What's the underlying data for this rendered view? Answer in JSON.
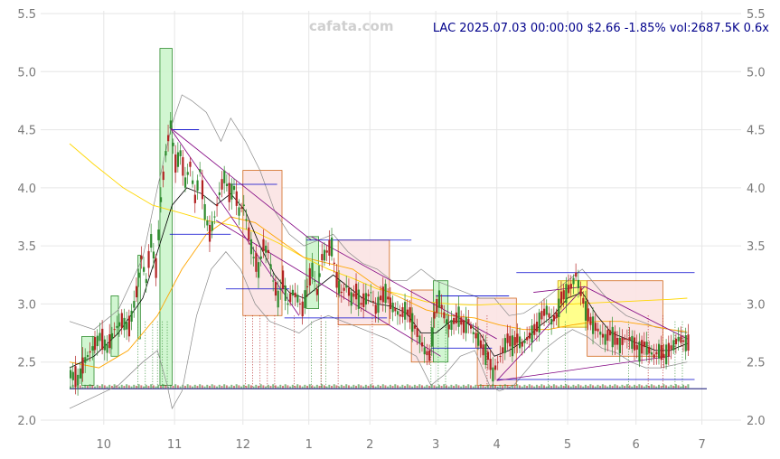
{
  "watermark": "cafata.com",
  "header": "LAC 2025.07.03 00:00:00 $2.66 -1.85% vol:2687.5K 0.6x",
  "colors": {
    "up": "#2e8b2e",
    "down": "#b22222",
    "box_green_fill": "#ccf5cc",
    "box_red_fill": "#fbe3e3",
    "box_red_edge": "#d2691e",
    "box_yellow_fill": "#ffff66",
    "ma_short": "#000000",
    "ma_mid": "#ffa500",
    "ma_long": "#ffd700",
    "bollinger": "#888888",
    "trend": "#800080",
    "level": "#0000cd",
    "grid": "#e6e6e6",
    "tick": "#7a7a7a"
  },
  "chart_data": {
    "type": "candlestick",
    "ylim": [
      2.0,
      5.5
    ],
    "yticks": [
      "2.0",
      "2.5",
      "3.0",
      "3.5",
      "4.0",
      "4.5",
      "5.0",
      "5.5"
    ],
    "ytick_values": [
      2.0,
      2.5,
      3.0,
      3.5,
      4.0,
      4.5,
      5.0,
      5.5
    ],
    "xlim": [
      0,
      261
    ],
    "xtick_labels": [
      "10",
      "11",
      "12",
      "1",
      "2",
      "3",
      "4",
      "5",
      "6",
      "7"
    ],
    "xtick_positions": [
      14,
      43,
      71,
      98,
      123,
      150,
      175,
      204,
      232,
      259
    ],
    "price_series": [
      [
        0,
        2.4
      ],
      [
        3,
        2.35
      ],
      [
        6,
        2.52
      ],
      [
        9,
        2.62
      ],
      [
        12,
        2.72
      ],
      [
        15,
        2.62
      ],
      [
        18,
        2.78
      ],
      [
        21,
        2.85
      ],
      [
        24,
        2.8
      ],
      [
        27,
        3.1
      ],
      [
        29,
        3.4
      ],
      [
        31,
        3.2
      ],
      [
        33,
        3.55
      ],
      [
        35,
        3.3
      ],
      [
        37,
        3.9
      ],
      [
        39,
        4.3
      ],
      [
        41,
        4.55
      ],
      [
        43,
        4.2
      ],
      [
        45,
        4.3
      ],
      [
        47,
        4.05
      ],
      [
        49,
        4.2
      ],
      [
        51,
        3.9
      ],
      [
        53,
        4.15
      ],
      [
        55,
        3.8
      ],
      [
        57,
        3.6
      ],
      [
        59,
        3.75
      ],
      [
        61,
        3.95
      ],
      [
        63,
        4.1
      ],
      [
        65,
        3.95
      ],
      [
        67,
        4.0
      ],
      [
        69,
        3.8
      ],
      [
        71,
        3.85
      ],
      [
        73,
        3.6
      ],
      [
        75,
        3.4
      ],
      [
        77,
        3.3
      ],
      [
        79,
        3.5
      ],
      [
        81,
        3.45
      ],
      [
        83,
        3.2
      ],
      [
        85,
        3.05
      ],
      [
        87,
        3.2
      ],
      [
        89,
        3.0
      ],
      [
        91,
        3.1
      ],
      [
        93,
        3.05
      ],
      [
        95,
        2.95
      ],
      [
        97,
        3.15
      ],
      [
        99,
        3.3
      ],
      [
        101,
        3.1
      ],
      [
        103,
        3.4
      ],
      [
        105,
        3.45
      ],
      [
        107,
        3.5
      ],
      [
        109,
        3.2
      ],
      [
        111,
        3.1
      ],
      [
        113,
        3.15
      ],
      [
        115,
        3.05
      ],
      [
        117,
        3.1
      ],
      [
        119,
        3.0
      ],
      [
        121,
        3.05
      ],
      [
        123,
        3.1
      ],
      [
        125,
        2.95
      ],
      [
        127,
        3.05
      ],
      [
        129,
        3.1
      ],
      [
        131,
        3.0
      ],
      [
        133,
        2.95
      ],
      [
        135,
        2.9
      ],
      [
        137,
        2.95
      ],
      [
        139,
        2.9
      ],
      [
        141,
        2.8
      ],
      [
        143,
        2.7
      ],
      [
        145,
        2.6
      ],
      [
        147,
        2.55
      ],
      [
        149,
        2.9
      ],
      [
        151,
        3.05
      ],
      [
        153,
        2.9
      ],
      [
        155,
        2.8
      ],
      [
        157,
        2.85
      ],
      [
        159,
        2.9
      ],
      [
        161,
        2.8
      ],
      [
        163,
        2.85
      ],
      [
        165,
        2.75
      ],
      [
        167,
        2.7
      ],
      [
        169,
        2.6
      ],
      [
        171,
        2.55
      ],
      [
        173,
        2.4
      ],
      [
        175,
        2.5
      ],
      [
        177,
        2.6
      ],
      [
        179,
        2.7
      ],
      [
        181,
        2.65
      ],
      [
        183,
        2.7
      ],
      [
        185,
        2.65
      ],
      [
        187,
        2.7
      ],
      [
        189,
        2.75
      ],
      [
        191,
        2.8
      ],
      [
        193,
        2.9
      ],
      [
        195,
        2.95
      ],
      [
        197,
        2.85
      ],
      [
        199,
        2.9
      ],
      [
        201,
        3.05
      ],
      [
        203,
        3.1
      ],
      [
        205,
        3.15
      ],
      [
        207,
        3.25
      ],
      [
        209,
        3.1
      ],
      [
        211,
        2.95
      ],
      [
        213,
        2.85
      ],
      [
        215,
        2.8
      ],
      [
        217,
        2.75
      ],
      [
        219,
        2.7
      ],
      [
        221,
        2.75
      ],
      [
        223,
        2.7
      ],
      [
        225,
        2.65
      ],
      [
        227,
        2.7
      ],
      [
        229,
        2.7
      ],
      [
        231,
        2.65
      ],
      [
        233,
        2.6
      ],
      [
        235,
        2.65
      ],
      [
        237,
        2.6
      ],
      [
        239,
        2.55
      ],
      [
        241,
        2.6
      ],
      [
        243,
        2.55
      ],
      [
        245,
        2.6
      ],
      [
        247,
        2.65
      ],
      [
        249,
        2.7
      ],
      [
        251,
        2.68
      ],
      [
        253,
        2.66
      ]
    ],
    "ma_short": [
      [
        0,
        2.45
      ],
      [
        10,
        2.55
      ],
      [
        20,
        2.75
      ],
      [
        30,
        3.05
      ],
      [
        36,
        3.45
      ],
      [
        42,
        3.85
      ],
      [
        48,
        4.0
      ],
      [
        54,
        3.95
      ],
      [
        60,
        3.85
      ],
      [
        66,
        3.95
      ],
      [
        72,
        3.8
      ],
      [
        78,
        3.5
      ],
      [
        84,
        3.25
      ],
      [
        90,
        3.1
      ],
      [
        96,
        3.05
      ],
      [
        102,
        3.15
      ],
      [
        108,
        3.25
      ],
      [
        114,
        3.15
      ],
      [
        120,
        3.05
      ],
      [
        126,
        3.0
      ],
      [
        132,
        2.98
      ],
      [
        138,
        2.92
      ],
      [
        144,
        2.75
      ],
      [
        150,
        2.75
      ],
      [
        156,
        2.85
      ],
      [
        162,
        2.85
      ],
      [
        168,
        2.75
      ],
      [
        174,
        2.55
      ],
      [
        180,
        2.6
      ],
      [
        186,
        2.68
      ],
      [
        192,
        2.8
      ],
      [
        198,
        2.9
      ],
      [
        204,
        3.05
      ],
      [
        210,
        3.1
      ],
      [
        216,
        2.9
      ],
      [
        222,
        2.75
      ],
      [
        228,
        2.7
      ],
      [
        234,
        2.65
      ],
      [
        240,
        2.6
      ],
      [
        246,
        2.6
      ],
      [
        253,
        2.66
      ]
    ],
    "ma_mid": [
      [
        0,
        2.5
      ],
      [
        12,
        2.45
      ],
      [
        24,
        2.6
      ],
      [
        36,
        2.9
      ],
      [
        46,
        3.3
      ],
      [
        56,
        3.6
      ],
      [
        66,
        3.75
      ],
      [
        76,
        3.7
      ],
      [
        86,
        3.55
      ],
      [
        96,
        3.4
      ],
      [
        106,
        3.35
      ],
      [
        116,
        3.3
      ],
      [
        126,
        3.15
      ],
      [
        136,
        3.05
      ],
      [
        146,
        2.95
      ],
      [
        156,
        2.9
      ],
      [
        166,
        2.88
      ],
      [
        176,
        2.82
      ],
      [
        186,
        2.78
      ],
      [
        196,
        2.78
      ],
      [
        206,
        2.82
      ],
      [
        216,
        2.85
      ],
      [
        226,
        2.85
      ],
      [
        236,
        2.82
      ],
      [
        246,
        2.78
      ],
      [
        253,
        2.76
      ]
    ],
    "ma_long": [
      [
        0,
        4.38
      ],
      [
        10,
        4.2
      ],
      [
        22,
        4.0
      ],
      [
        34,
        3.85
      ],
      [
        46,
        3.78
      ],
      [
        56,
        3.72
      ],
      [
        66,
        3.68
      ],
      [
        76,
        3.62
      ],
      [
        86,
        3.52
      ],
      [
        96,
        3.4
      ],
      [
        106,
        3.3
      ],
      [
        116,
        3.22
      ],
      [
        126,
        3.13
      ],
      [
        136,
        3.08
      ],
      [
        146,
        3.02
      ],
      [
        156,
        3.0
      ],
      [
        166,
        2.99
      ],
      [
        176,
        3.0
      ],
      [
        186,
        3.0
      ],
      [
        196,
        3.0
      ],
      [
        206,
        3.0
      ],
      [
        216,
        3.01
      ],
      [
        226,
        3.02
      ],
      [
        236,
        3.03
      ],
      [
        246,
        3.04
      ],
      [
        253,
        3.05
      ]
    ],
    "boll_upper": [
      [
        0,
        2.85
      ],
      [
        10,
        2.78
      ],
      [
        20,
        2.95
      ],
      [
        30,
        3.4
      ],
      [
        36,
        4.0
      ],
      [
        42,
        4.55
      ],
      [
        46,
        4.8
      ],
      [
        50,
        4.75
      ],
      [
        56,
        4.65
      ],
      [
        62,
        4.4
      ],
      [
        66,
        4.6
      ],
      [
        72,
        4.4
      ],
      [
        78,
        4.15
      ],
      [
        84,
        3.8
      ],
      [
        90,
        3.6
      ],
      [
        96,
        3.5
      ],
      [
        102,
        3.55
      ],
      [
        108,
        3.6
      ],
      [
        114,
        3.45
      ],
      [
        120,
        3.35
      ],
      [
        126,
        3.3
      ],
      [
        132,
        3.2
      ],
      [
        138,
        3.2
      ],
      [
        144,
        3.3
      ],
      [
        150,
        3.2
      ],
      [
        156,
        3.15
      ],
      [
        162,
        3.1
      ],
      [
        168,
        3.05
      ],
      [
        174,
        3.05
      ],
      [
        180,
        2.9
      ],
      [
        186,
        2.92
      ],
      [
        192,
        3.0
      ],
      [
        198,
        3.1
      ],
      [
        204,
        3.2
      ],
      [
        210,
        3.3
      ],
      [
        216,
        3.15
      ],
      [
        222,
        3.0
      ],
      [
        228,
        2.9
      ],
      [
        234,
        2.85
      ],
      [
        240,
        2.8
      ],
      [
        246,
        2.78
      ],
      [
        253,
        2.75
      ]
    ],
    "boll_lower": [
      [
        0,
        2.1
      ],
      [
        10,
        2.2
      ],
      [
        20,
        2.3
      ],
      [
        30,
        2.5
      ],
      [
        36,
        2.6
      ],
      [
        40,
        2.3
      ],
      [
        42,
        2.1
      ],
      [
        46,
        2.25
      ],
      [
        52,
        2.9
      ],
      [
        58,
        3.3
      ],
      [
        64,
        3.45
      ],
      [
        70,
        3.3
      ],
      [
        76,
        3.0
      ],
      [
        82,
        2.85
      ],
      [
        88,
        2.8
      ],
      [
        94,
        2.75
      ],
      [
        100,
        2.85
      ],
      [
        106,
        2.9
      ],
      [
        112,
        2.85
      ],
      [
        118,
        2.8
      ],
      [
        124,
        2.75
      ],
      [
        130,
        2.7
      ],
      [
        136,
        2.62
      ],
      [
        142,
        2.55
      ],
      [
        148,
        2.3
      ],
      [
        154,
        2.4
      ],
      [
        160,
        2.55
      ],
      [
        166,
        2.6
      ],
      [
        172,
        2.3
      ],
      [
        176,
        2.25
      ],
      [
        182,
        2.3
      ],
      [
        188,
        2.45
      ],
      [
        194,
        2.6
      ],
      [
        200,
        2.7
      ],
      [
        206,
        2.78
      ],
      [
        212,
        2.72
      ],
      [
        218,
        2.62
      ],
      [
        224,
        2.58
      ],
      [
        230,
        2.5
      ],
      [
        236,
        2.45
      ],
      [
        242,
        2.45
      ],
      [
        253,
        2.5
      ]
    ],
    "boxes": [
      {
        "x0": 5,
        "x1": 10,
        "y0": 2.3,
        "y1": 2.72,
        "kind": "green"
      },
      {
        "x0": 17,
        "x1": 20,
        "y0": 2.55,
        "y1": 3.07,
        "kind": "green"
      },
      {
        "x0": 28,
        "x1": 29,
        "y0": 2.7,
        "y1": 3.42,
        "kind": "green"
      },
      {
        "x0": 37,
        "x1": 42,
        "y0": 2.3,
        "y1": 5.2,
        "kind": "green"
      },
      {
        "x0": 71,
        "x1": 87,
        "y0": 2.9,
        "y1": 4.15,
        "kind": "red"
      },
      {
        "x0": 97,
        "x1": 102,
        "y0": 2.96,
        "y1": 3.58,
        "kind": "green"
      },
      {
        "x0": 110,
        "x1": 131,
        "y0": 2.82,
        "y1": 3.55,
        "kind": "red"
      },
      {
        "x0": 140,
        "x1": 150,
        "y0": 2.5,
        "y1": 3.12,
        "kind": "red"
      },
      {
        "x0": 149,
        "x1": 155,
        "y0": 2.5,
        "y1": 3.2,
        "kind": "green"
      },
      {
        "x0": 167,
        "x1": 183,
        "y0": 2.3,
        "y1": 3.05,
        "kind": "red"
      },
      {
        "x0": 200,
        "x1": 212,
        "y0": 2.8,
        "y1": 3.2,
        "kind": "yellow"
      },
      {
        "x0": 212,
        "x1": 243,
        "y0": 2.55,
        "y1": 3.2,
        "kind": "red"
      }
    ],
    "trend_lines": [
      [
        41,
        4.52,
        99,
        3.55
      ],
      [
        41,
        4.52,
        94,
        2.9
      ],
      [
        60,
        3.72,
        152,
        2.55
      ],
      [
        99,
        3.58,
        175,
        2.7
      ],
      [
        175,
        2.34,
        246,
        2.55
      ],
      [
        175,
        2.34,
        211,
        3.15
      ],
      [
        211,
        3.15,
        253,
        2.7
      ],
      [
        190,
        3.1,
        211,
        3.15
      ]
    ],
    "levels": [
      [
        42,
        4.5,
        53,
        4.5
      ],
      [
        64,
        4.03,
        85,
        4.03
      ],
      [
        41,
        3.6,
        66,
        3.6
      ],
      [
        97,
        3.55,
        140,
        3.55
      ],
      [
        64,
        3.13,
        90,
        3.13
      ],
      [
        88,
        2.88,
        130,
        2.88
      ],
      [
        150,
        3.07,
        180,
        3.07
      ],
      [
        148,
        2.62,
        173,
        2.62
      ],
      [
        183,
        3.27,
        256,
        3.27
      ],
      [
        175,
        2.35,
        256,
        2.35
      ]
    ]
  }
}
